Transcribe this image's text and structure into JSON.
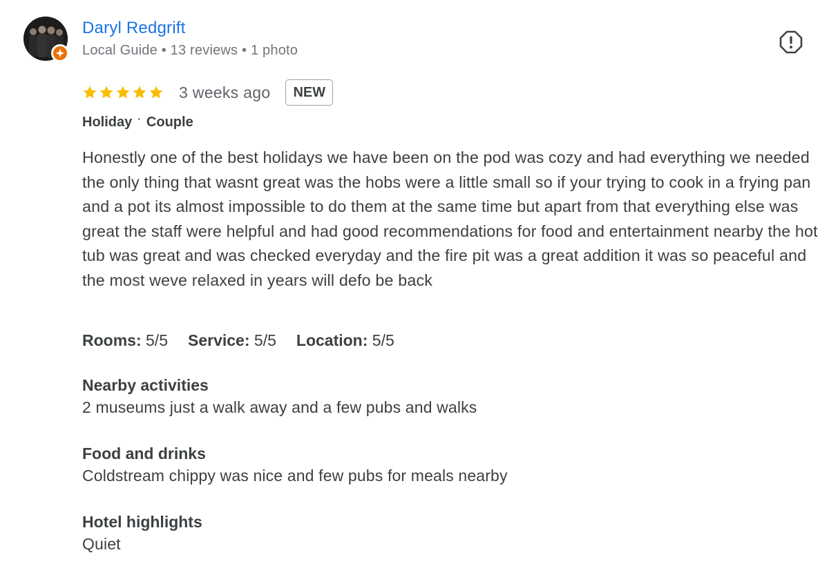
{
  "reviewer": {
    "name": "Daryl Redgrift",
    "meta": "Local Guide • 13 reviews • 1 photo",
    "avatar_icon": "reviewer-photo",
    "badge_icon": "local-guide-star-icon",
    "badge_color": "#e8710a"
  },
  "report": {
    "icon": "report-icon"
  },
  "review": {
    "rating": 5,
    "rating_max": 5,
    "star_color": "#fbbc04",
    "time_ago": "3 weeks ago",
    "new_badge": "NEW",
    "trip_purpose": "Holiday",
    "trip_separator": "·",
    "trip_companion": "Couple",
    "text": "Honestly one of the best holidays we have been on the pod was cozy and had everything we needed the only thing that wasnt great was the hobs were a little small so if your trying to cook in a frying pan and a pot its almost impossible to do them at the same time but apart from that everything else was great the staff were helpful and had good recommendations for food and entertainment nearby the hot tub was great and was checked everyday and the fire pit was a great addition it was so peaceful and the most weve relaxed in years will defo be back"
  },
  "ratings": [
    {
      "label": "Rooms:",
      "value": "5/5"
    },
    {
      "label": "Service:",
      "value": "5/5"
    },
    {
      "label": "Location:",
      "value": "5/5"
    }
  ],
  "sections": [
    {
      "heading": "Nearby activities",
      "body": "2 museums just a walk away and a few pubs and walks"
    },
    {
      "heading": "Food and drinks",
      "body": "Coldstream chippy was nice and few pubs for meals nearby"
    },
    {
      "heading": "Hotel highlights",
      "body": "Quiet"
    }
  ],
  "colors": {
    "link_blue": "#1a73e8",
    "text": "#3c4043",
    "muted": "#70757a"
  }
}
